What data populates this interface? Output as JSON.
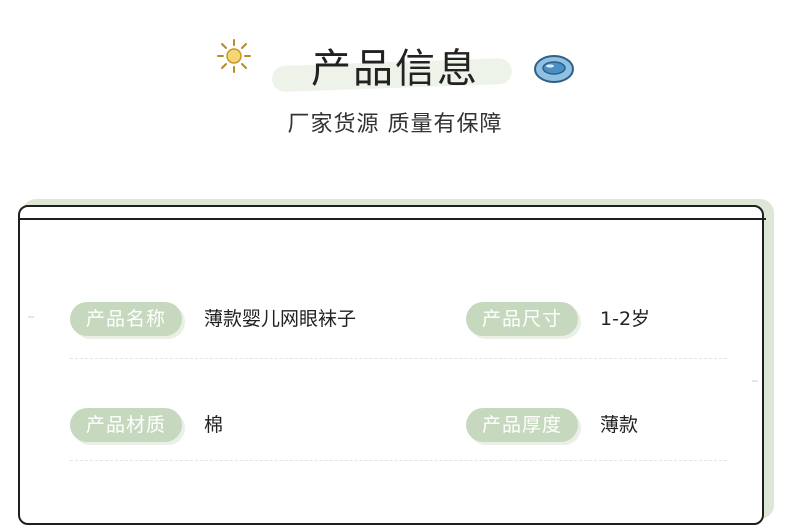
{
  "header": {
    "title": "产品信息",
    "subtitle": "厂家货源  质量有保障"
  },
  "info": {
    "rows": [
      {
        "left": {
          "label": "产品名称",
          "value": "薄款婴儿网眼袜子"
        },
        "right": {
          "label": "产品尺寸",
          "value": "1-2岁"
        }
      },
      {
        "left": {
          "label": "产品材质",
          "value": "棉"
        },
        "right": {
          "label": "产品厚度",
          "value": "薄款"
        }
      }
    ]
  },
  "colors": {
    "pill": "#c6d9bf",
    "card_shadow": "#dce8d5",
    "accent_blue": "#3f8fc4",
    "sun": "#e5b93a"
  },
  "icons": {
    "left": "sun-icon",
    "right": "plate-icon"
  }
}
